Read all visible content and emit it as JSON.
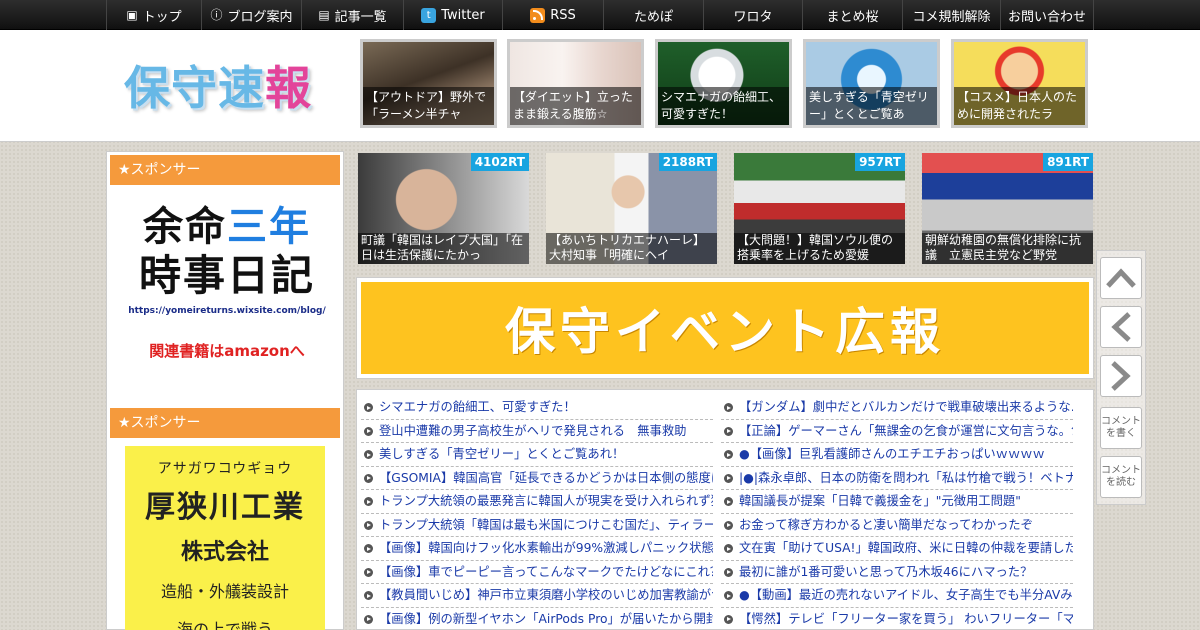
{
  "nav": {
    "items": [
      {
        "label": "トップ",
        "icon": "home-icon"
      },
      {
        "label": "ブログ案内",
        "icon": "info-icon"
      },
      {
        "label": "記事一覧",
        "icon": "list-icon"
      },
      {
        "label": "Twitter",
        "icon": "twitter-icon"
      },
      {
        "label": "RSS",
        "icon": "rss-icon"
      },
      {
        "label": "ためぽ",
        "icon": ""
      },
      {
        "label": "ワロタ",
        "icon": ""
      },
      {
        "label": "まとめ桜",
        "icon": ""
      },
      {
        "label": "コメ規制解除",
        "icon": ""
      },
      {
        "label": "お問い合わせ",
        "icon": ""
      }
    ]
  },
  "header": {
    "logo_text_a": "保守速",
    "logo_text_b": "報",
    "thumbs": [
      {
        "caption": "【アウトドア】野外で「ラーメン半チャ"
      },
      {
        "caption": "【ダイエット】立ったまま鍛える腹筋☆"
      },
      {
        "caption": "シマエナガの飴細工、可愛すぎた！"
      },
      {
        "caption": "美しすぎる「青空ゼリー」とくとご覧あ"
      },
      {
        "caption": "【コスメ】日本人のために開発されたラ"
      }
    ]
  },
  "sidebar": {
    "sponsor_label": "★スポンサー",
    "ad1": {
      "line1_a": "余命",
      "line1_b": "三年",
      "line2": "時事日記",
      "url": "https://yomeireturns.wixsite.com/blog/",
      "amazon": "関連書籍はamazonへ"
    },
    "ad2": {
      "kana": "アサガワコウギョウ",
      "name": "厚狭川工業",
      "kk": "株式会社",
      "biz": "造船・外艤装設計",
      "more": "海の上で戦う"
    }
  },
  "ranking": [
    {
      "rt": "4102RT",
      "caption": "町議「韓国はレイプ大国」「在日は生活保護にたかっ"
    },
    {
      "rt": "2188RT",
      "caption": "【あいちトリカエナハーレ】大村知事「明確にヘイ"
    },
    {
      "rt": "957RT",
      "caption": "【大問題！】韓国ソウル便の搭乗率を上げるため愛媛"
    },
    {
      "rt": "891RT",
      "caption": "朝鮮幼稚園の無償化排除に抗議　立憲民主党など野党"
    }
  ],
  "banner": {
    "text": "保守イベント広報"
  },
  "links_left": [
    "シマエナガの飴細工、可愛すぎた！",
    "登山中遭難の男子高校生がヘリで発見される　無事救助",
    "美しすぎる「青空ゼリー」とくとご覧あれ！",
    "【GSOMIA】韓国高官「延長できるかどうかは日本側の態度に",
    "トランプ大統領の最悪発言に韓国人が現実を受け入れられず狼",
    "トランプ大統領「韓国は最も米国につけこむ国だ」、ティラー",
    "【画像】韓国向けフッ化水素輸出が99%激減しパニック状態！",
    "【画像】車でピーピー言ってこんなマークでたけどなにこれ？",
    "【教員間いじめ】神戸市立東須磨小学校のいじめ加害教諭がつ",
    "【画像】例の新型イヤホン「AirPods Pro」が届いたから開封し"
  ],
  "links_right": [
    "【ガンダム】劇中だとバルカンだけで戦車破壊出来るような…",
    "【正論】ゲーマーさん「無課金の乞食が運営に文句言うな。乞",
    "●【画像】巨乳看護師さんのエチエチおっぱいｗｗｗｗ",
    "|●|森永卓郎、日本の防衛を問われ「私は竹槍で戦う！ベトナム",
    "韓国議長が提案「日韓で義援金を」\"元徴用工問題\"",
    "お金って稼ぎ方わかると凄い簡単だなってわかったぞ",
    "文在寅「助けてUSA!」韓国政府、米に日韓の仲裁を要請したと",
    "最初に誰が1番可愛いと思って乃木坂46にハマった？",
    "●【動画】最近の売れないアイドル、女子高生でも半分AVみた",
    "【愕然】テレビ「フリーター家を買う」 わいフリーター「マシ"
  ],
  "sidenav": {
    "comment_write": "コメントを書く",
    "comment_read": "コメントを読む"
  }
}
